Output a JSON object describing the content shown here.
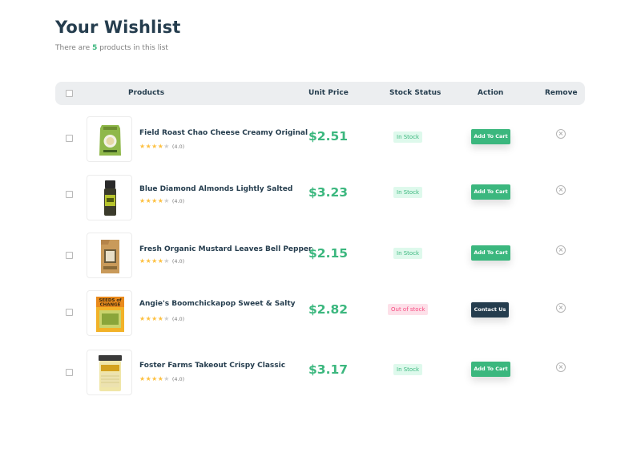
{
  "page": {
    "title": "Your Wishlist",
    "subtitle_prefix": "There are ",
    "subtitle_count": "5",
    "subtitle_suffix": " products in this list"
  },
  "table": {
    "headers": {
      "products": "Products",
      "unit_price": "Unit Price",
      "stock_status": "Stock Status",
      "action": "Action",
      "remove": "Remove"
    }
  },
  "items": [
    {
      "name": "Field Roast Chao Cheese Creamy Original",
      "rating": 4,
      "rating_text": "(4.0)",
      "price": "$2.51",
      "stock": "In Stock",
      "stock_state": "in",
      "action": "Add To Cart",
      "action_type": "cart",
      "image_icon": "cheese-bag-icon"
    },
    {
      "name": "Blue Diamond Almonds Lightly Salted",
      "rating": 4,
      "rating_text": "(4.0)",
      "price": "$3.23",
      "stock": "In Stock",
      "stock_state": "in",
      "action": "Add To Cart",
      "action_type": "cart",
      "image_icon": "spice-jar-icon"
    },
    {
      "name": "Fresh Organic Mustard Leaves Bell Pepper",
      "rating": 4,
      "rating_text": "(4.0)",
      "price": "$2.15",
      "stock": "In Stock",
      "stock_state": "in",
      "action": "Add To Cart",
      "action_type": "cart",
      "image_icon": "paper-bag-icon"
    },
    {
      "name": "Angie's Boomchickapop Sweet & Salty",
      "rating": 4,
      "rating_text": "(4.0)",
      "price": "$2.82",
      "stock": "Out of stock",
      "stock_state": "out",
      "action": "Contact Us",
      "action_type": "contact",
      "image_icon": "seed-packet-icon"
    },
    {
      "name": "Foster Farms Takeout Crispy Classic",
      "rating": 4,
      "rating_text": "(4.0)",
      "price": "$3.17",
      "stock": "In Stock",
      "stock_state": "in",
      "action": "Add To Cart",
      "action_type": "cart",
      "image_icon": "container-jar-icon"
    }
  ],
  "packet_text": {
    "line1": "SEEDS of",
    "line2": "CHANGE"
  },
  "colors": {
    "brand": "#3bb77e",
    "heading": "#253d4e",
    "out_of_stock": "#f74b81",
    "star": "#fdc040"
  }
}
